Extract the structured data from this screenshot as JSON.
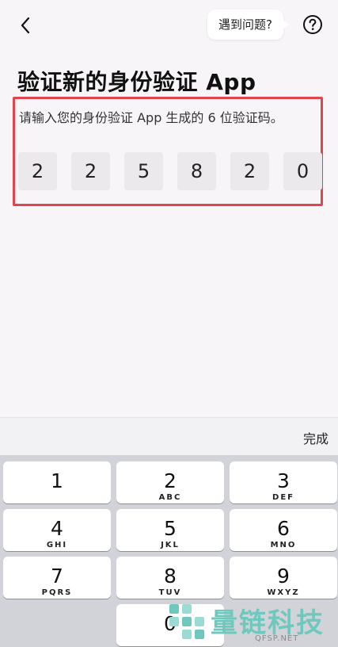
{
  "header": {
    "help_bubble": "遇到问题?"
  },
  "title": "验证新的身份验证 App",
  "subtitle": "请输入您的身份验证 App 生成的 6 位验证码。",
  "code": {
    "digits": [
      "2",
      "2",
      "5",
      "8",
      "2",
      "0"
    ]
  },
  "keyboard_bar": {
    "done_label": "完成"
  },
  "keys": [
    {
      "num": "1",
      "letters": ""
    },
    {
      "num": "2",
      "letters": "ABC"
    },
    {
      "num": "3",
      "letters": "DEF"
    },
    {
      "num": "4",
      "letters": "GHI"
    },
    {
      "num": "5",
      "letters": "JKL"
    },
    {
      "num": "6",
      "letters": "MNO"
    },
    {
      "num": "7",
      "letters": "PQRS"
    },
    {
      "num": "8",
      "letters": "TUV"
    },
    {
      "num": "9",
      "letters": "WXYZ"
    },
    {
      "num": "0",
      "letters": ""
    }
  ],
  "watermark": {
    "brand": "量链科技",
    "domain": "QFSP.NET"
  },
  "colors": {
    "highlight": "#e0454f",
    "watermark": "#6fc8be"
  }
}
